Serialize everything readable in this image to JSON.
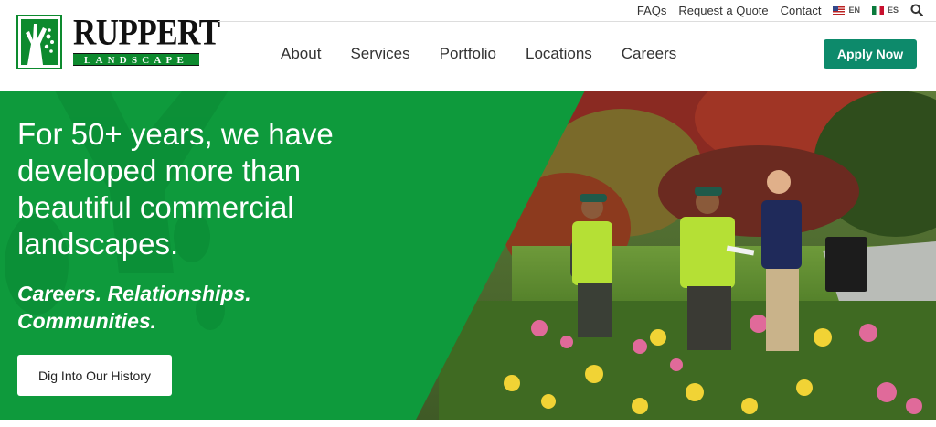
{
  "brand": {
    "name": "RUPPERT",
    "tagline": "LANDSCAPE",
    "logo_icon": "tree-icon",
    "color": "#0d8a2e"
  },
  "utility": {
    "faqs": "FAQs",
    "quote": "Request a Quote",
    "contact": "Contact",
    "lang_en": "EN",
    "lang_es": "ES",
    "search_icon": "search-icon"
  },
  "nav": {
    "items": [
      "About",
      "Services",
      "Portfolio",
      "Locations",
      "Careers"
    ],
    "apply_label": "Apply Now",
    "apply_color": "#0d8a6b"
  },
  "hero": {
    "title": "For 50+ years, we have developed more than beautiful commercial landscapes.",
    "subtitle_line1": "Careers. Relationships.",
    "subtitle_line2": "Communities.",
    "button_label": "Dig Into Our History",
    "green": "#0e9a3c"
  }
}
